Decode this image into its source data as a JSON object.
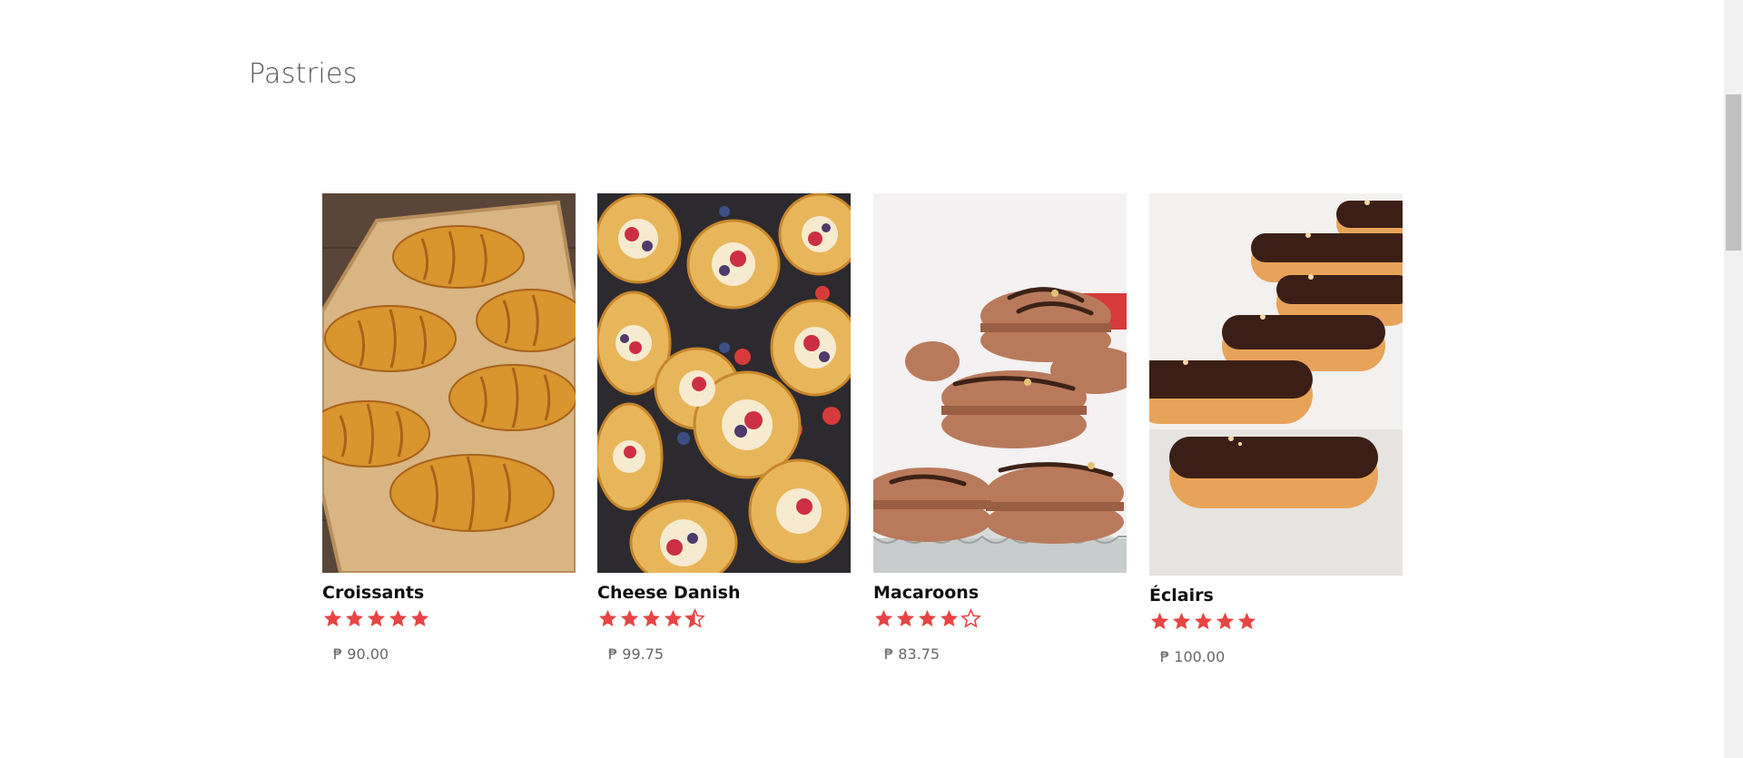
{
  "section": {
    "title": "Pastries"
  },
  "products": [
    {
      "name": "Croissants",
      "rating": 5,
      "price": "₱ 90.00"
    },
    {
      "name": "Cheese Danish",
      "rating": 4.5,
      "price": "₱ 99.75"
    },
    {
      "name": "Macaroons",
      "rating": 4,
      "price": "₱ 83.75"
    },
    {
      "name": "Éclairs",
      "rating": 5,
      "price": "₱ 100.00"
    }
  ],
  "colors": {
    "star": "#e74444",
    "heading": "#555555",
    "price": "#666666"
  },
  "icons": {
    "star_full": "star-icon",
    "star_half": "star-half-icon",
    "star_empty": "star-empty-icon"
  }
}
